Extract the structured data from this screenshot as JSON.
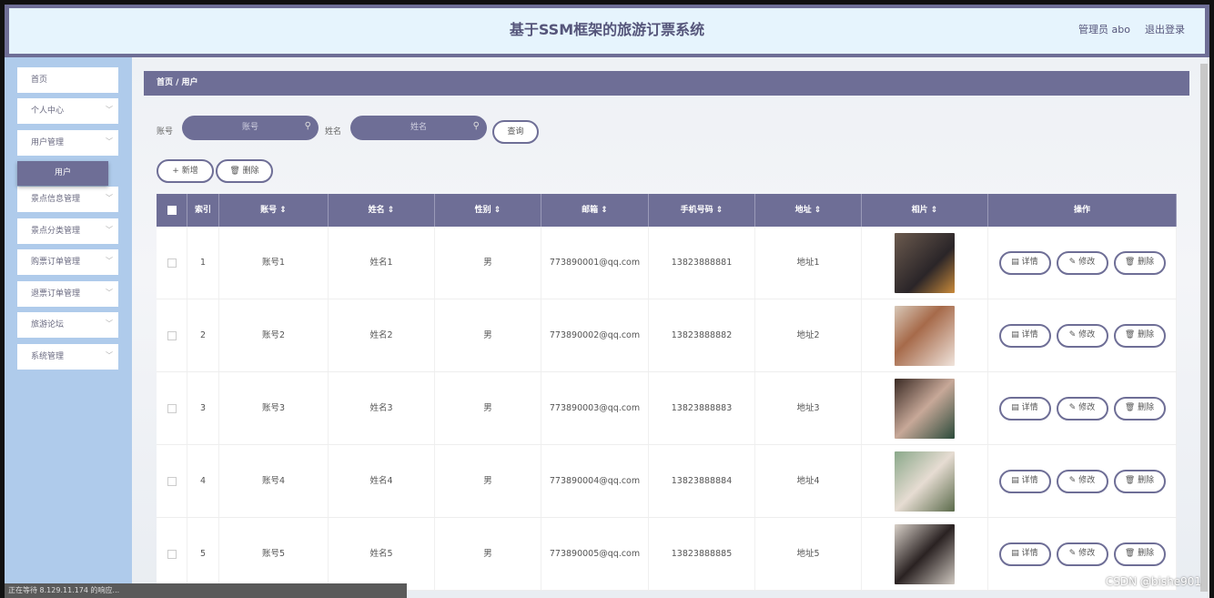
{
  "header": {
    "title": "基于SSM框架的旅游订票系统",
    "user": "管理员 abo",
    "logout": "退出登录"
  },
  "sidebar": {
    "items": [
      {
        "label": "首页"
      },
      {
        "label": "个人中心"
      },
      {
        "label": "用户管理"
      },
      {
        "label": "景点信息管理"
      },
      {
        "label": "景点分类管理"
      },
      {
        "label": "购票订单管理"
      },
      {
        "label": "退票订单管理"
      },
      {
        "label": "旅游论坛"
      },
      {
        "label": "系统管理"
      }
    ],
    "sub_active": "用户"
  },
  "breadcrumb": "首页 / 用户",
  "search": {
    "account_label": "账号",
    "account_placeholder": "账号",
    "name_label": "姓名",
    "name_placeholder": "姓名",
    "query": "查询"
  },
  "actions": {
    "add": "+ 新增",
    "delete": "删除"
  },
  "table": {
    "headers": [
      "索引",
      "账号 ⇕",
      "姓名 ⇕",
      "性别 ⇕",
      "邮箱 ⇕",
      "手机号码 ⇕",
      "地址 ⇕",
      "相片 ⇕",
      "操作"
    ],
    "rows": [
      {
        "index": "1",
        "account": "账号1",
        "name": "姓名1",
        "gender": "男",
        "email": "773890001@qq.com",
        "phone": "13823888881",
        "address": "地址1"
      },
      {
        "index": "2",
        "account": "账号2",
        "name": "姓名2",
        "gender": "男",
        "email": "773890002@qq.com",
        "phone": "13823888882",
        "address": "地址2"
      },
      {
        "index": "3",
        "account": "账号3",
        "name": "姓名3",
        "gender": "男",
        "email": "773890003@qq.com",
        "phone": "13823888883",
        "address": "地址3"
      },
      {
        "index": "4",
        "account": "账号4",
        "name": "姓名4",
        "gender": "男",
        "email": "773890004@qq.com",
        "phone": "13823888884",
        "address": "地址4"
      },
      {
        "index": "5",
        "account": "账号5",
        "name": "姓名5",
        "gender": "男",
        "email": "773890005@qq.com",
        "phone": "13823888885",
        "address": "地址5"
      }
    ],
    "ops": {
      "detail": "详情",
      "edit": "修改",
      "delete": "删除"
    }
  },
  "status_bar": "正在等待 8.129.11.174 的响应...",
  "watermark": "CSDN @bishe901"
}
